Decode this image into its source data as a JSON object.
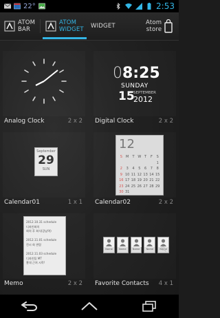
{
  "status_bar": {
    "temperature": "22°",
    "time": "2:53"
  },
  "tabs": [
    {
      "label_line1": "ATOM",
      "label_line2": "BAR"
    },
    {
      "label_line1": "ATOM",
      "label_line2": "WIDGET"
    },
    {
      "label_line1": "WIDGET",
      "label_line2": ""
    }
  ],
  "store": {
    "line1": "Atom",
    "line2": "store"
  },
  "widgets": [
    {
      "name": "Analog Clock",
      "size": "2 x 2"
    },
    {
      "name": "Digital Clock",
      "size": "2 x 2"
    },
    {
      "name": "Calendar01",
      "size": "1 x 1"
    },
    {
      "name": "Calendar02",
      "size": "2 x 2"
    },
    {
      "name": "Memo",
      "size": "2 x 2"
    },
    {
      "name": "Favorite Contacts",
      "size": "4 x 1"
    }
  ],
  "digital_clock": {
    "time_light": "0",
    "time_bold": "8:25",
    "weekday": "SUNDAY",
    "day": "15",
    "month": "SEPTEMBER",
    "year": "2012"
  },
  "calendar01": {
    "header": "September",
    "day": "29",
    "weekday": "SUN"
  },
  "calendar02": {
    "month": "12",
    "weekdays": [
      "S",
      "M",
      "T",
      "W",
      "T",
      "F",
      "S"
    ],
    "rows": [
      [
        "",
        "",
        "",
        "",
        "",
        "",
        "1"
      ],
      [
        "2",
        "3",
        "4",
        "5",
        "6",
        "7",
        "8"
      ],
      [
        "9",
        "10",
        "11",
        "12",
        "13",
        "14",
        "15"
      ],
      [
        "16",
        "17",
        "18",
        "19",
        "20",
        "21",
        "22"
      ],
      [
        "23",
        "24",
        "25",
        "26",
        "27",
        "28",
        "29"
      ],
      [
        "30",
        "31",
        "",
        "",
        "",
        "",
        ""
      ]
    ]
  },
  "memo": {
    "lines": [
      "2012.10.31 schedule",
      "디자인회의",
      "회의 후 회식(강남역)",
      "",
      "2012.11.01 schedule",
      "전시 회 관람",
      "",
      "2012.11.03 schedule",
      "디자인팀 MT",
      "홍대 근처 시작!"
    ]
  },
  "favorite_contacts": {
    "names": [
      "Name",
      "Name",
      "Name",
      "Name",
      "Name"
    ]
  },
  "colors": {
    "accent": "#33b5e5",
    "calendar_red": "#d9534f"
  }
}
